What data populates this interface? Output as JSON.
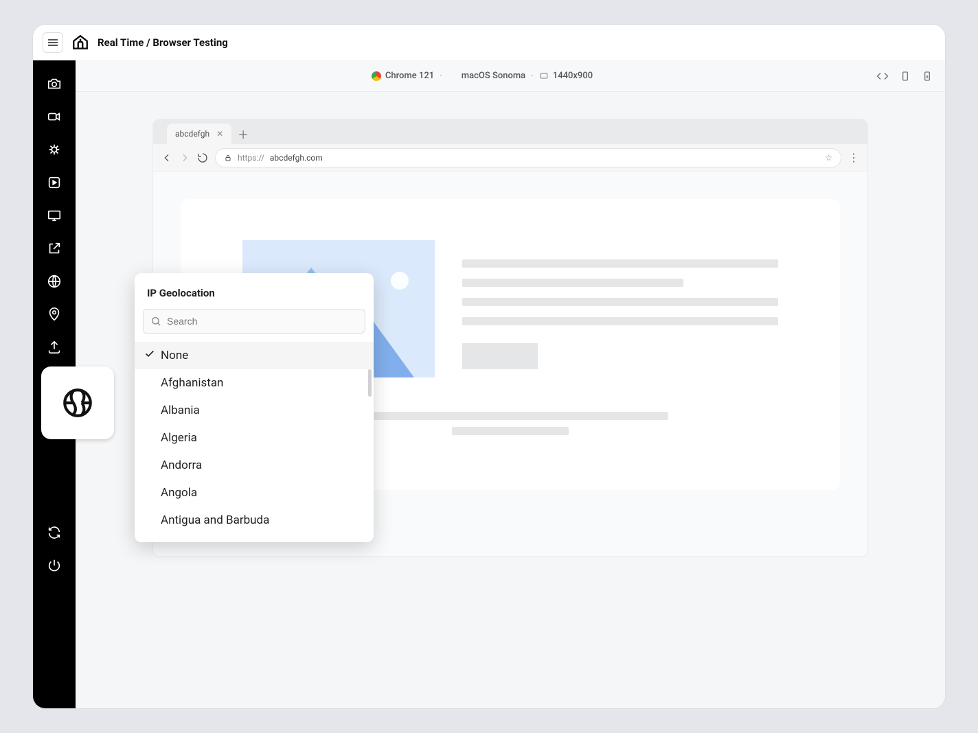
{
  "header": {
    "breadcrumb": "Real Time / Browser Testing"
  },
  "subheader": {
    "browser": "Chrome 121",
    "os": "macOS Sonoma",
    "resolution": "1440x900"
  },
  "browser": {
    "tab_title": "abcdefgh",
    "url_scheme": "https://",
    "url_host": "abcdefgh.com"
  },
  "geo": {
    "title": "IP Geolocation",
    "search_placeholder": "Search",
    "selected": "None",
    "items": [
      "None",
      "Afghanistan",
      "Albania",
      "Algeria",
      "Andorra",
      "Angola",
      "Antigua and Barbuda"
    ]
  },
  "sidebar_tools": [
    "camera",
    "video",
    "bug",
    "record-play",
    "monitor",
    "external-link",
    "globe",
    "pin",
    "upload",
    "folder",
    "chrome-browser",
    "ip-geolocation",
    "sync",
    "power"
  ]
}
